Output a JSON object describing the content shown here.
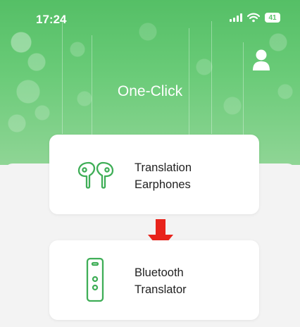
{
  "status_bar": {
    "time": "17:24",
    "battery_level": "41",
    "icons": [
      "cellular-signal-icon",
      "wifi-icon",
      "battery-icon"
    ]
  },
  "header": {
    "title": "One-Click",
    "profile_icon": "person-icon"
  },
  "options": [
    {
      "line1": "Translation",
      "line2": "Earphones",
      "icon": "earbuds-icon"
    },
    {
      "line1": "Bluetooth",
      "line2": "Translator",
      "icon": "translator-device-icon"
    }
  ],
  "colors": {
    "hero_green": "#5ac36a",
    "icon_green": "#3fae57",
    "arrow_red": "#e8231b",
    "background": "#f3f3f3",
    "card": "#ffffff"
  }
}
